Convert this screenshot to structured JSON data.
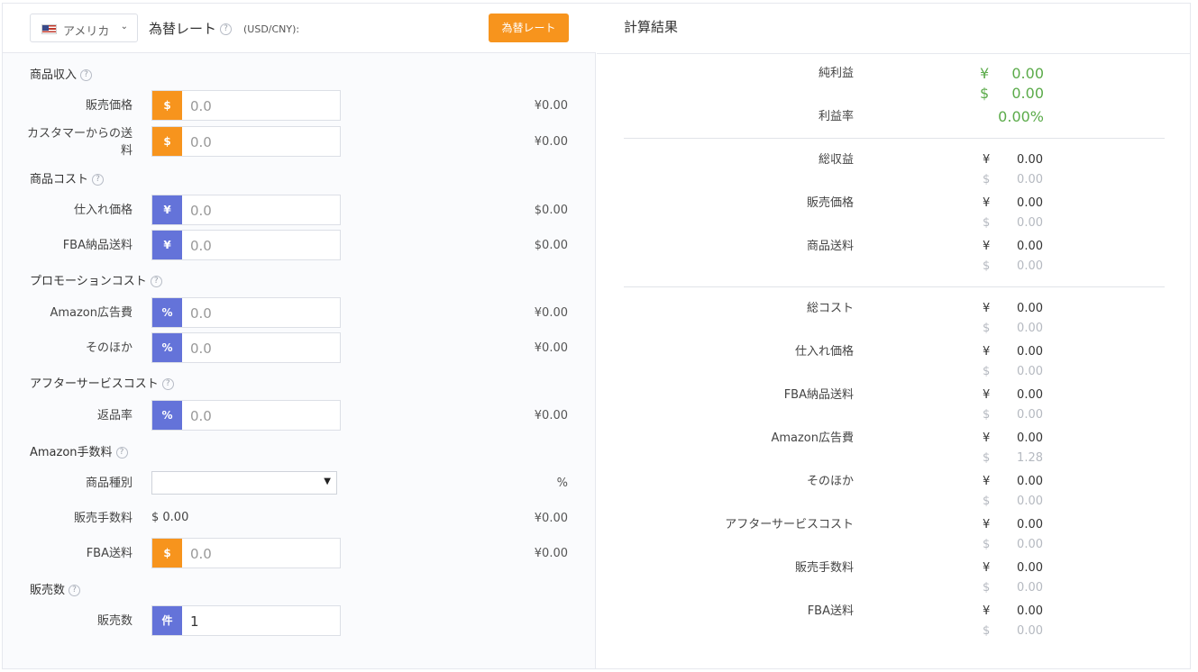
{
  "header": {
    "country": "アメリカ",
    "rate_title": "為替レート",
    "rate_unit": "(USD/CNY):",
    "rate_button": "為替レート"
  },
  "left": {
    "sections": {
      "income": "商品収入",
      "cost": "商品コスト",
      "promo": "プロモーションコスト",
      "after": "アフターサービスコスト",
      "fees": "Amazon手数料",
      "sales": "販売数"
    },
    "rows": {
      "sale_price": {
        "label": "販売価格",
        "badge": "$",
        "value": "0.0",
        "amount": "¥0.00"
      },
      "shipping_from_customer": {
        "label": "カスタマーからの送料",
        "badge": "$",
        "value": "0.0",
        "amount": "¥0.00"
      },
      "purchase_price": {
        "label": "仕入れ価格",
        "badge": "¥",
        "value": "0.0",
        "amount": "$0.00"
      },
      "fba_inbound": {
        "label": "FBA納品送料",
        "badge": "¥",
        "value": "0.0",
        "amount": "$0.00"
      },
      "amazon_ads": {
        "label": "Amazon広告費",
        "badge": "%",
        "value": "0.0",
        "amount": "¥0.00"
      },
      "other": {
        "label": "そのほか",
        "badge": "%",
        "value": "0.0",
        "amount": "¥0.00"
      },
      "return_rate": {
        "label": "返品率",
        "badge": "%",
        "value": "0.0",
        "amount": "¥0.00"
      },
      "category": {
        "label": "商品種別",
        "selected": "",
        "amount": "%"
      },
      "sales_fee": {
        "label": "販売手数料",
        "value": "$ 0.00",
        "amount": "¥0.00"
      },
      "fba_fee": {
        "label": "FBA送料",
        "badge": "$",
        "value": "0.0",
        "amount": "¥0.00"
      },
      "quantity": {
        "label": "販売数",
        "badge": "件",
        "value": "1"
      }
    }
  },
  "right": {
    "title": "計算結果",
    "net_profit": {
      "label": "純利益",
      "cny_symbol": "¥",
      "cny": "0.00",
      "usd_symbol": "$",
      "usd": "0.00"
    },
    "margin": {
      "label": "利益率",
      "value": "0.00%"
    },
    "currency_symbols": {
      "cny": "¥",
      "usd": "$"
    },
    "items": [
      {
        "label": "総収益",
        "cny": "0.00",
        "usd": "0.00"
      },
      {
        "label": "販売価格",
        "cny": "0.00",
        "usd": "0.00"
      },
      {
        "label": "商品送料",
        "cny": "0.00",
        "usd": "0.00"
      },
      {
        "label": "総コスト",
        "cny": "0.00",
        "usd": "0.00"
      },
      {
        "label": "仕入れ価格",
        "cny": "0.00",
        "usd": "0.00"
      },
      {
        "label": "FBA納品送料",
        "cny": "0.00",
        "usd": "0.00"
      },
      {
        "label": "Amazon広告費",
        "cny": "0.00",
        "usd": "1.28"
      },
      {
        "label": "そのほか",
        "cny": "0.00",
        "usd": "0.00"
      },
      {
        "label": "アフターサービスコスト",
        "cny": "0.00",
        "usd": "0.00"
      },
      {
        "label": "販売手数料",
        "cny": "0.00",
        "usd": "0.00"
      },
      {
        "label": "FBA送料",
        "cny": "0.00",
        "usd": "0.00"
      }
    ]
  }
}
